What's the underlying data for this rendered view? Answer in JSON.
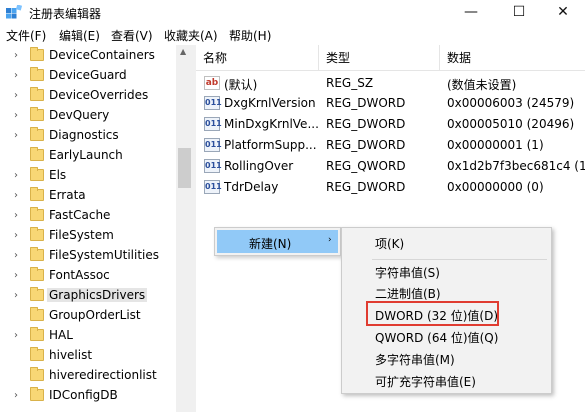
{
  "window": {
    "title": "注册表编辑器",
    "minimize_glyph": "—",
    "maximize_glyph": "☐",
    "close_glyph": "✕"
  },
  "menubar": [
    "文件(F)",
    "编辑(E)",
    "查看(V)",
    "收藏夹(A)",
    "帮助(H)"
  ],
  "tree": {
    "items": [
      {
        "label": "DeviceContainers",
        "expandable": true
      },
      {
        "label": "DeviceGuard",
        "expandable": true
      },
      {
        "label": "DeviceOverrides",
        "expandable": true
      },
      {
        "label": "DevQuery",
        "expandable": true
      },
      {
        "label": "Diagnostics",
        "expandable": true
      },
      {
        "label": "EarlyLaunch",
        "expandable": false
      },
      {
        "label": "Els",
        "expandable": true
      },
      {
        "label": "Errata",
        "expandable": true
      },
      {
        "label": "FastCache",
        "expandable": true
      },
      {
        "label": "FileSystem",
        "expandable": true
      },
      {
        "label": "FileSystemUtilities",
        "expandable": true
      },
      {
        "label": "FontAssoc",
        "expandable": true
      },
      {
        "label": "GraphicsDrivers",
        "expandable": true,
        "selected": true
      },
      {
        "label": "GroupOrderList",
        "expandable": false
      },
      {
        "label": "HAL",
        "expandable": true
      },
      {
        "label": "hivelist",
        "expandable": false
      },
      {
        "label": "hiveredirectionlist",
        "expandable": false
      },
      {
        "label": "IDConfigDB",
        "expandable": true
      }
    ]
  },
  "list": {
    "columns": [
      "名称",
      "类型",
      "数据"
    ],
    "rows": [
      {
        "icon": "string-value-icon",
        "icon_text": "ab",
        "name": "(默认)",
        "type": "REG_SZ",
        "data": "(数值未设置)"
      },
      {
        "icon": "binary-value-icon",
        "icon_text": "011",
        "name": "DxgKrnlVersion",
        "type": "REG_DWORD",
        "data": "0x00006003 (24579)"
      },
      {
        "icon": "binary-value-icon",
        "icon_text": "011",
        "name": "MinDxgKrnlVe...",
        "type": "REG_DWORD",
        "data": "0x00005010 (20496)"
      },
      {
        "icon": "binary-value-icon",
        "icon_text": "011",
        "name": "PlatformSupp...",
        "type": "REG_DWORD",
        "data": "0x00000001 (1)"
      },
      {
        "icon": "binary-value-icon",
        "icon_text": "011",
        "name": "RollingOver",
        "type": "REG_QWORD",
        "data": "0x1d2b7f3bec681c4 (13"
      },
      {
        "icon": "binary-value-icon",
        "icon_text": "011",
        "name": "TdrDelay",
        "type": "REG_DWORD",
        "data": "0x00000000 (0)"
      }
    ]
  },
  "context_menu": {
    "new_label": "新建(N)",
    "submenu_arrow": "›"
  },
  "submenu": {
    "key": "项(K)",
    "items": [
      "字符串值(S)",
      "二进制值(B)",
      "DWORD (32 位)值(D)",
      "QWORD (64 位)值(Q)",
      "多字符串值(M)",
      "可扩充字符串值(E)"
    ],
    "highlight_color": "#e03c31"
  }
}
